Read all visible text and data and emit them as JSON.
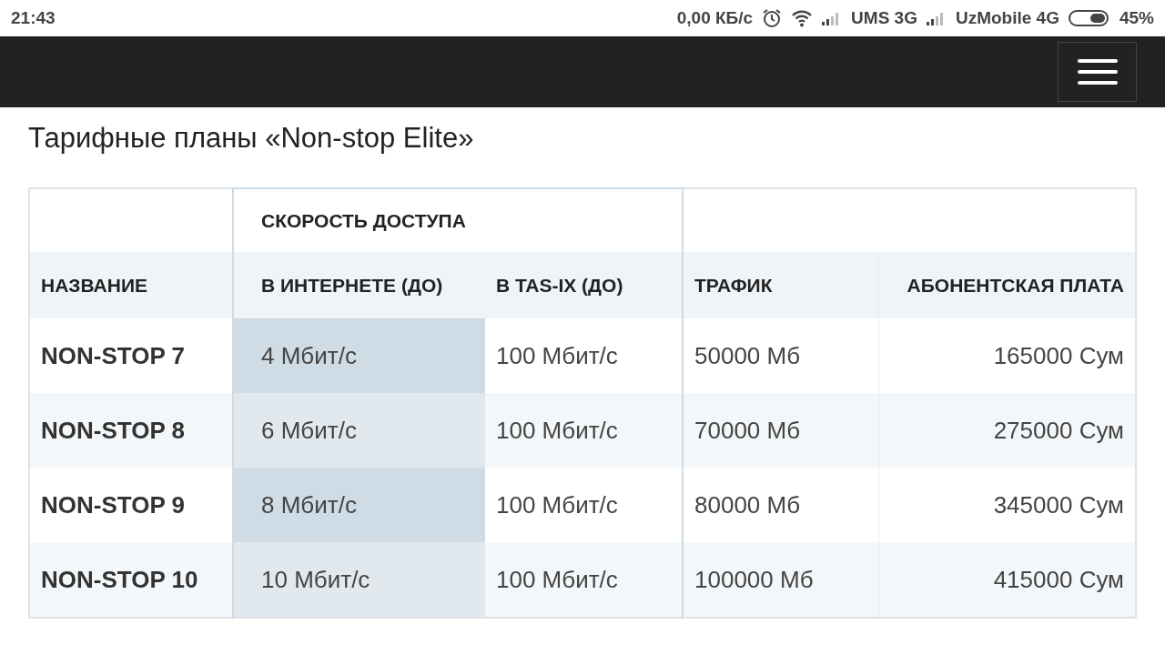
{
  "status_bar": {
    "time": "21:43",
    "speed": "0,00 КБ/с",
    "carrier_1": "UMS 3G",
    "carrier_2": "UzMobile 4G",
    "battery": "45%"
  },
  "page_title": "Тарифные планы «Non-stop Elite»",
  "table": {
    "group_header": "СКОРОСТЬ ДОСТУПА",
    "columns": [
      "НАЗВАНИЕ",
      "В ИНТЕРНЕТЕ (ДО)",
      "В TAS-IX (ДО)",
      "ТРАФИК",
      "АБОНЕНТСКАЯ ПЛАТА"
    ],
    "rows": [
      [
        "NON-STOP 7",
        "4 Мбит/с",
        "100 Мбит/с",
        "50000 Мб",
        "165000 Сум"
      ],
      [
        "NON-STOP 8",
        "6 Мбит/с",
        "100 Мбит/с",
        "70000 Мб",
        "275000 Сум"
      ],
      [
        "NON-STOP 9",
        "8 Мбит/с",
        "100 Мбит/с",
        "80000 Мб",
        "345000 Сум"
      ],
      [
        "NON-STOP 10",
        "10 Мбит/с",
        "100 Мбит/с",
        "100000 Мб",
        "415000 Сум"
      ]
    ]
  }
}
